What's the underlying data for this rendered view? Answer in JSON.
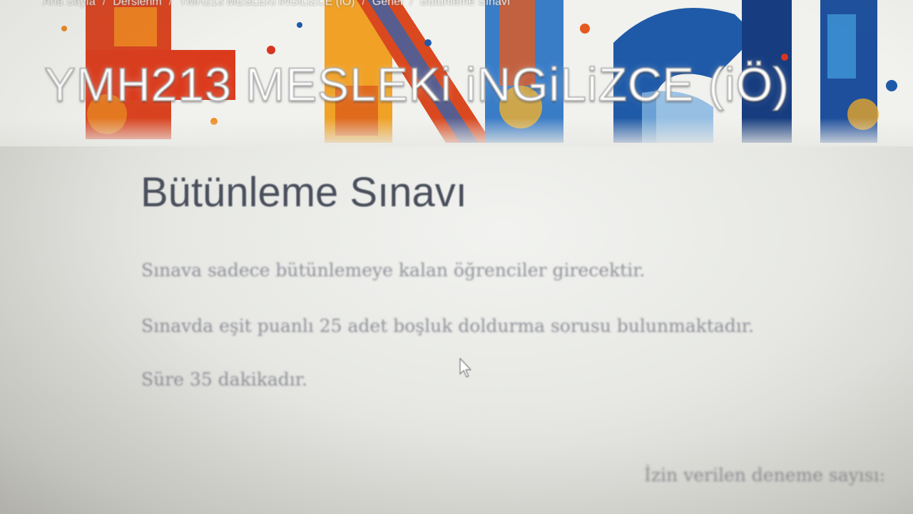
{
  "breadcrumb": {
    "items": [
      {
        "label": "Ana Sayfa"
      },
      {
        "label": "Derslerim"
      },
      {
        "label": "YMH213 MESLEKi iNGiLiZCE (iÖ)"
      },
      {
        "label": "Genel"
      },
      {
        "label": "Bütünleme Sınavı"
      }
    ],
    "separator": "/"
  },
  "banner": {
    "course_title": "YMH213 MESLEKi iNGiLiZCE (iÖ)"
  },
  "quiz": {
    "title": "Bütünleme Sınavı",
    "description": [
      "Sınava sadece bütünlemeye kalan öğrenciler girecektir.",
      "Sınavda eşit puanlı 25 adet boşluk doldurma sorusu bulunmaktadır.",
      "Süre 35 dakikadır."
    ],
    "attempts_label": "İzin verilen deneme sayısı:"
  },
  "colors": {
    "heading": "#4a4f5c",
    "body_text": "#8d8e97",
    "banner_red": "#d9341f",
    "banner_orange": "#e9861f",
    "banner_blue": "#1f5aa8"
  }
}
